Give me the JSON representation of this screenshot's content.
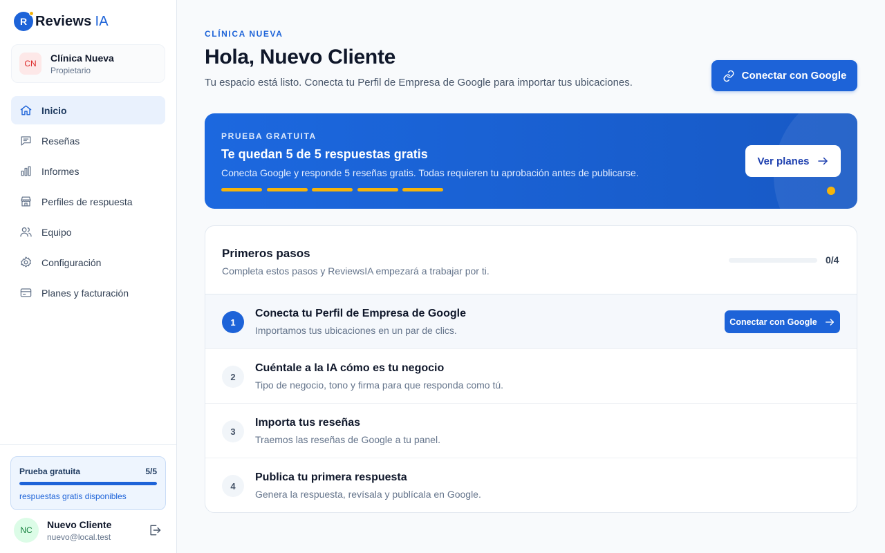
{
  "brand": {
    "mark": "R",
    "name": "Reviews",
    "accent": "IA"
  },
  "org": {
    "initials": "CN",
    "name": "Clínica Nueva",
    "role": "Propietario"
  },
  "nav": [
    {
      "label": "Inicio",
      "icon": "home-icon"
    },
    {
      "label": "Reseñas",
      "icon": "message-icon"
    },
    {
      "label": "Informes",
      "icon": "bar-chart-icon"
    },
    {
      "label": "Perfiles de respuesta",
      "icon": "store-icon"
    },
    {
      "label": "Equipo",
      "icon": "users-icon"
    },
    {
      "label": "Configuración",
      "icon": "gear-icon"
    },
    {
      "label": "Planes y facturación",
      "icon": "credit-card-icon"
    }
  ],
  "trial_card": {
    "label": "Prueba gratuita",
    "count": "5/5",
    "remaining_fraction": 1.0,
    "subtitle": "respuestas gratis disponibles"
  },
  "user": {
    "initials": "NC",
    "name": "Nuevo Cliente",
    "email": "nuevo@local.test"
  },
  "header": {
    "eyebrow": "CLÍNICA NUEVA",
    "title": "Hola, Nuevo Cliente",
    "subtitle": "Tu espacio está listo. Conecta tu Perfil de Empresa de Google para importar tus ubicaciones.",
    "connect_label": "Conectar con Google"
  },
  "banner": {
    "eyebrow": "PRUEBA GRATUITA",
    "title": "Te quedan 5 de 5 respuestas gratis",
    "subtitle": "Conecta Google y responde 5 reseñas gratis. Todas requieren tu aprobación antes de publicarse.",
    "segments_remaining": 5,
    "segments_total": 5,
    "cta": "Ver planes"
  },
  "steps": {
    "title": "Primeros pasos",
    "subtitle": "Completa estos pasos y ReviewsIA empezará a trabajar por ti.",
    "progress": "0/4",
    "progress_fraction": 0,
    "items": [
      {
        "num": "1",
        "title": "Conecta tu Perfil de Empresa de Google",
        "subtitle": "Importamos tus ubicaciones en un par de clics.",
        "cta": "Conectar con Google"
      },
      {
        "num": "2",
        "title": "Cuéntale a la IA cómo es tu negocio",
        "subtitle": "Tipo de negocio, tono y firma para que responda como tú."
      },
      {
        "num": "3",
        "title": "Importa tus reseñas",
        "subtitle": "Traemos las reseñas de Google a tu panel."
      },
      {
        "num": "4",
        "title": "Publica tu primera respuesta",
        "subtitle": "Genera la respuesta, revísala y publícala en Google."
      }
    ]
  },
  "colors": {
    "primary": "#1d63d8",
    "accent_yellow": "#f5b40b",
    "text": "#0f172a",
    "muted": "#64748b"
  }
}
